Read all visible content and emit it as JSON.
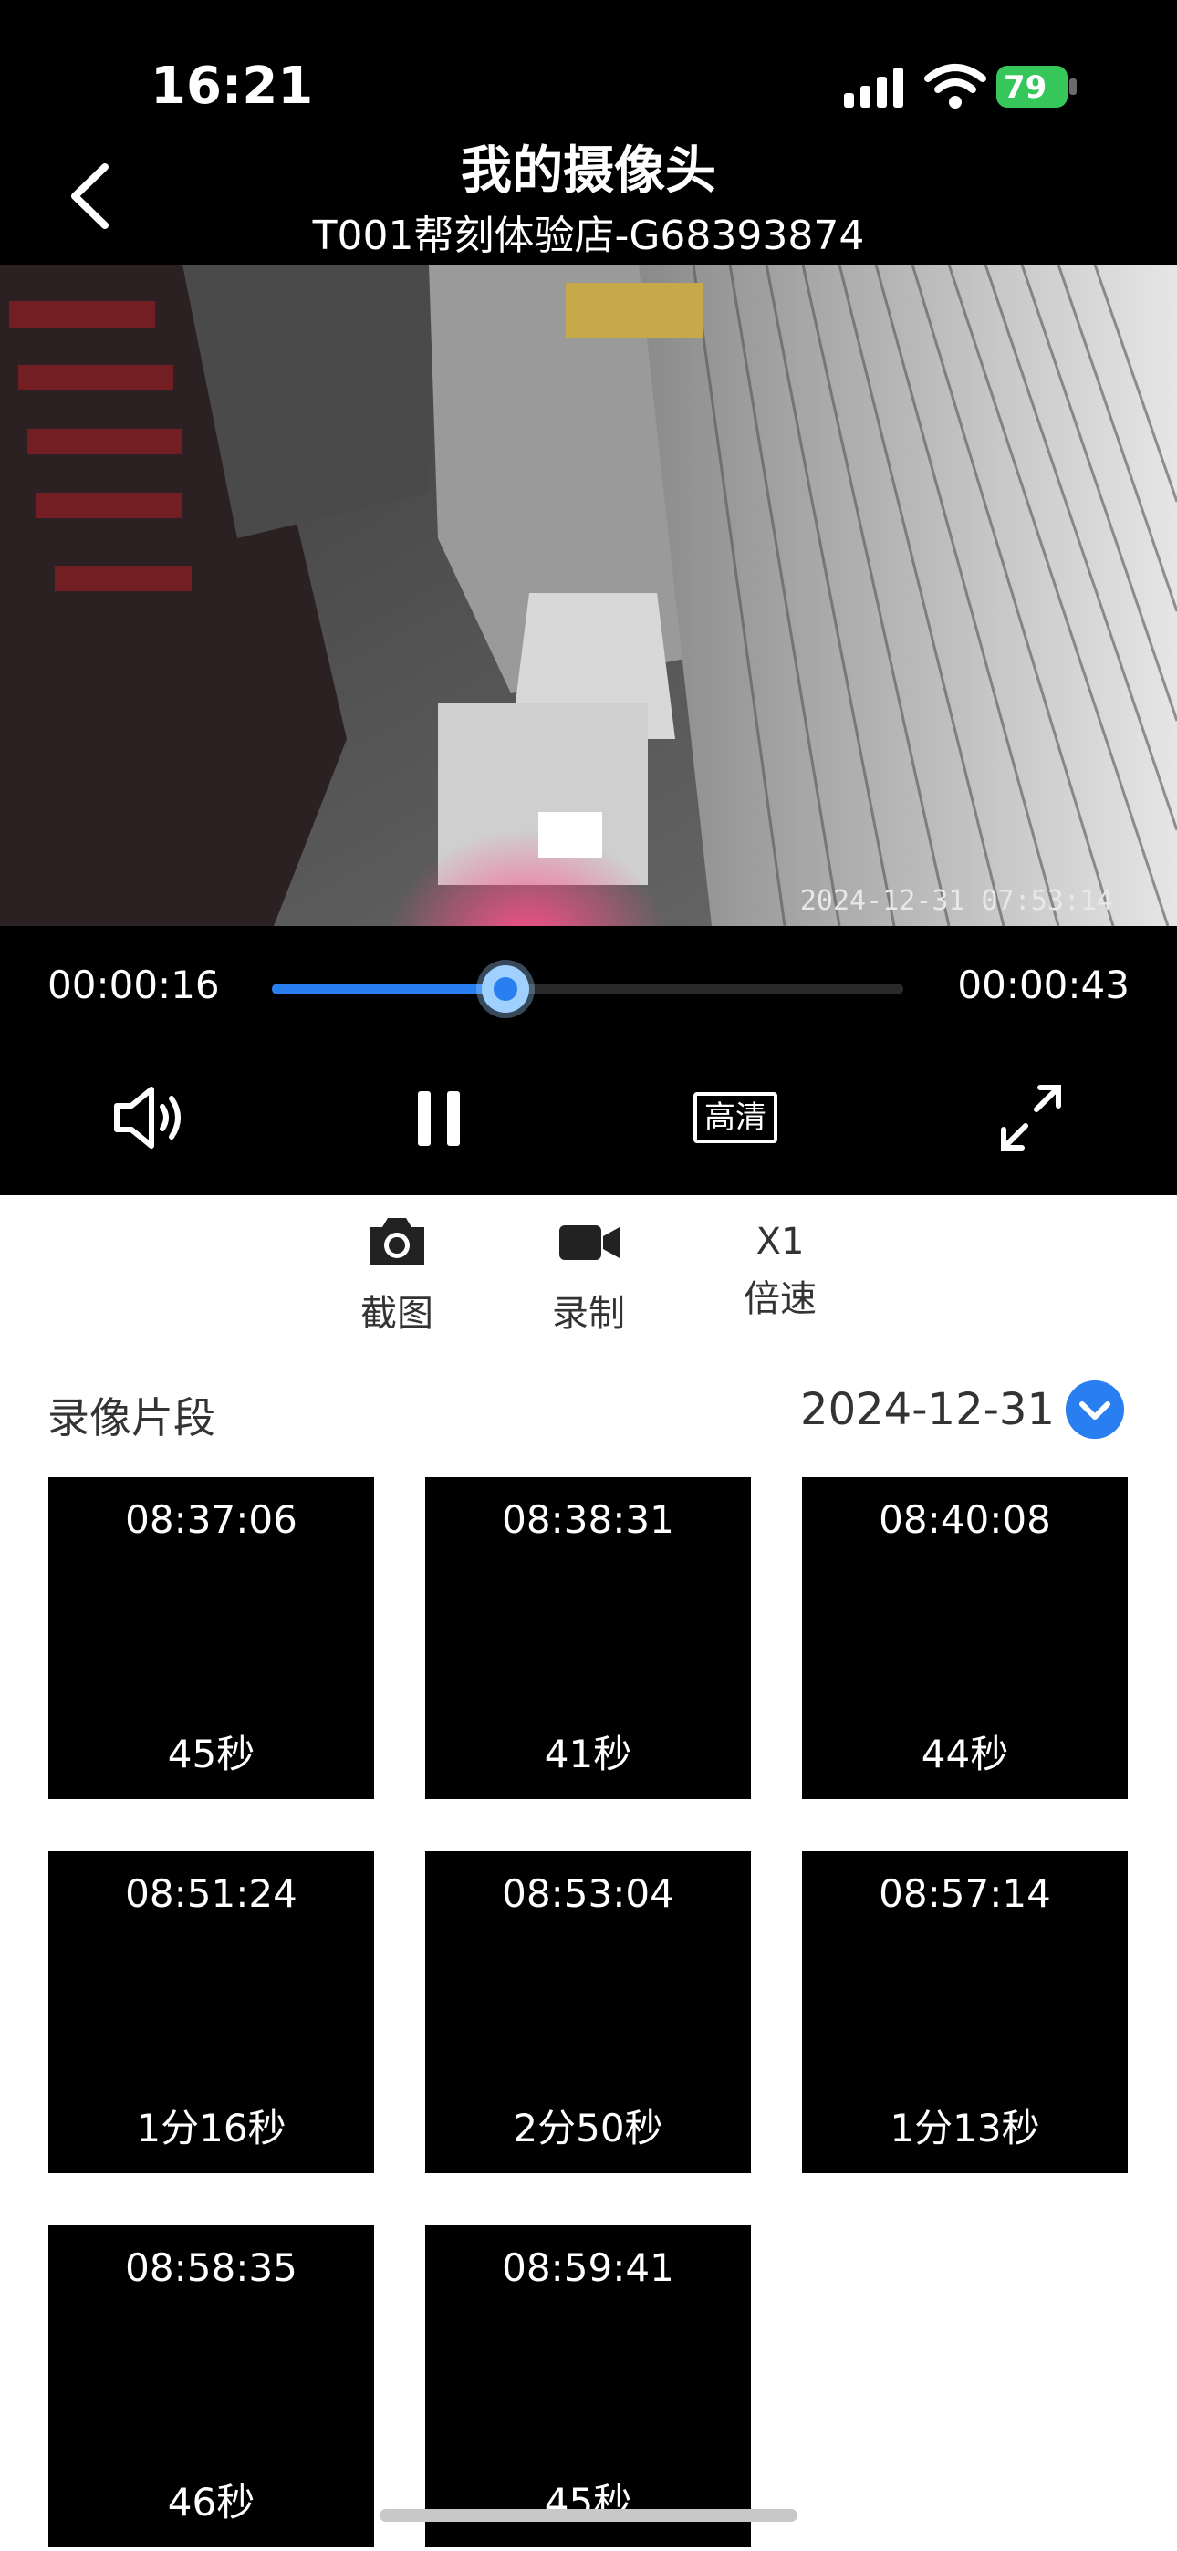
{
  "status_bar": {
    "time": "16:21",
    "battery": "79"
  },
  "header": {
    "title": "我的摄像头",
    "subtitle": "T001帮刻体验店-G68393874"
  },
  "video": {
    "osd_timestamp": "2024-12-31 07:53:14"
  },
  "player": {
    "elapsed": "00:00:16",
    "duration": "00:00:43",
    "progress_fraction": 0.37,
    "quality_label": "高清"
  },
  "actions": {
    "screenshot_label": "截图",
    "record_label": "录制",
    "speed_value": "X1",
    "speed_label": "倍速"
  },
  "recordings": {
    "section_title": "录像片段",
    "date": "2024-12-31",
    "clips": [
      {
        "time": "08:37:06",
        "duration": "45秒"
      },
      {
        "time": "08:38:31",
        "duration": "41秒"
      },
      {
        "time": "08:40:08",
        "duration": "44秒"
      },
      {
        "time": "08:51:24",
        "duration": "1分16秒"
      },
      {
        "time": "08:53:04",
        "duration": "2分50秒"
      },
      {
        "time": "08:57:14",
        "duration": "1分13秒"
      },
      {
        "time": "08:58:35",
        "duration": "46秒"
      },
      {
        "time": "08:59:41",
        "duration": "45秒"
      }
    ]
  },
  "colors": {
    "accent": "#2a7ff0",
    "battery": "#35c759"
  }
}
